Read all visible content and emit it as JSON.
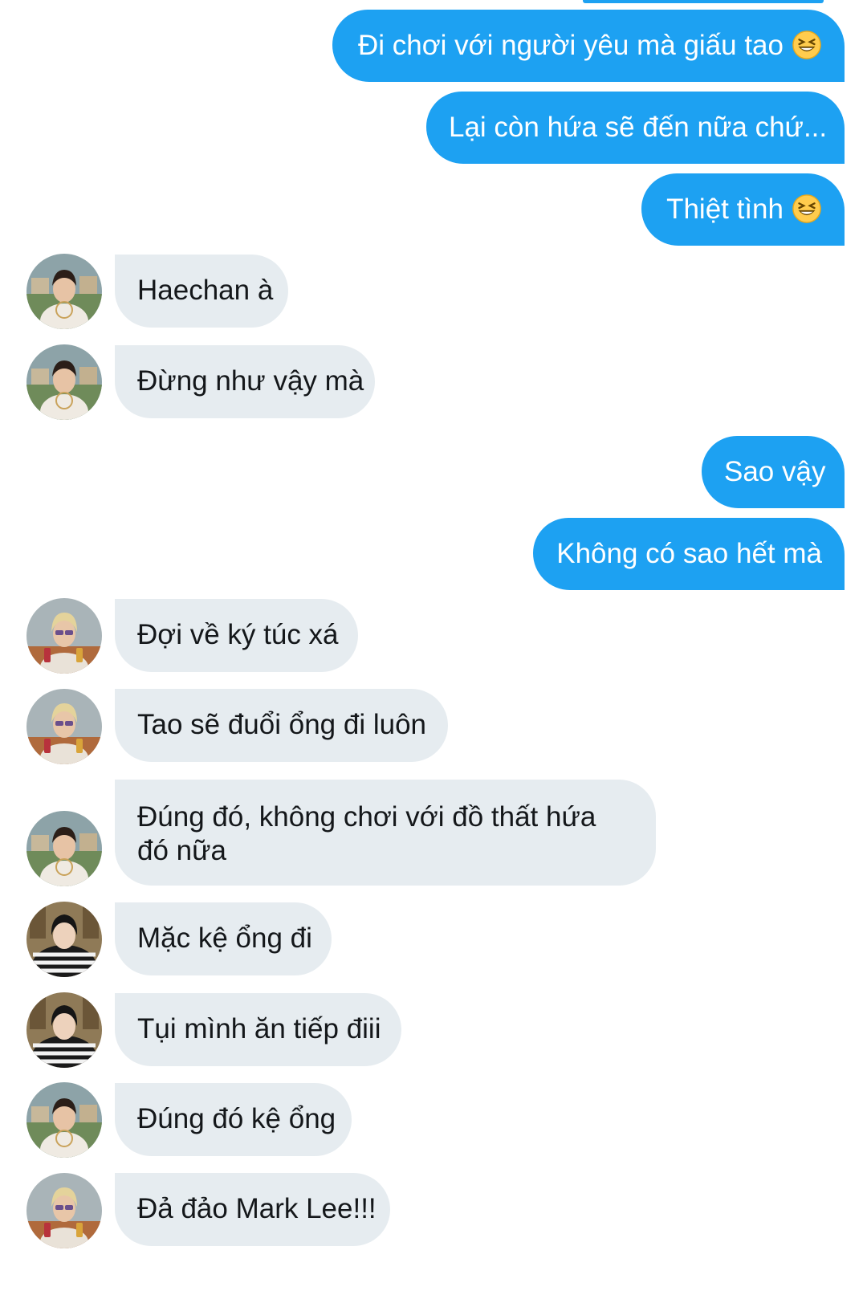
{
  "colors": {
    "sent_bubble": "#1DA1F2",
    "received_bubble": "#E6ECF0",
    "sent_text": "#FFFFFF",
    "received_text": "#14171A"
  },
  "messages": [
    {
      "direction": "sent",
      "text": "Đi chơi với người yêu mà giấu tao",
      "emoji": "grinning-squinting-face"
    },
    {
      "direction": "sent",
      "text": "Lại còn hứa sẽ đến nữa chứ..."
    },
    {
      "direction": "sent",
      "text": "Thiệt tình",
      "emoji": "grinning-squinting-face"
    },
    {
      "direction": "received",
      "avatar": "avatar-dark-hair-white-shirt",
      "text": "Haechan à"
    },
    {
      "direction": "received",
      "avatar": "avatar-dark-hair-white-shirt",
      "text": "Đừng như vậy mà"
    },
    {
      "direction": "sent",
      "text": "Sao vậy"
    },
    {
      "direction": "sent",
      "text": "Không có sao hết mà"
    },
    {
      "direction": "received",
      "avatar": "avatar-blonde-sunglasses",
      "text": "Đợi về ký túc xá"
    },
    {
      "direction": "received",
      "avatar": "avatar-blonde-sunglasses",
      "text": "Tao sẽ đuổi ổng đi luôn"
    },
    {
      "direction": "received",
      "avatar": "avatar-dark-hair-white-shirt",
      "text": "Đúng đó, không chơi với đồ thất hứa đó nữa"
    },
    {
      "direction": "received",
      "avatar": "avatar-striped-sweater",
      "text": "Mặc kệ ổng đi"
    },
    {
      "direction": "received",
      "avatar": "avatar-striped-sweater",
      "text": "Tụi mình ăn tiếp điii"
    },
    {
      "direction": "received",
      "avatar": "avatar-dark-hair-white-shirt",
      "text": "Đúng đó kệ ổng"
    },
    {
      "direction": "received",
      "avatar": "avatar-blonde-sunglasses",
      "text": "Đả đảo Mark Lee!!!"
    }
  ]
}
